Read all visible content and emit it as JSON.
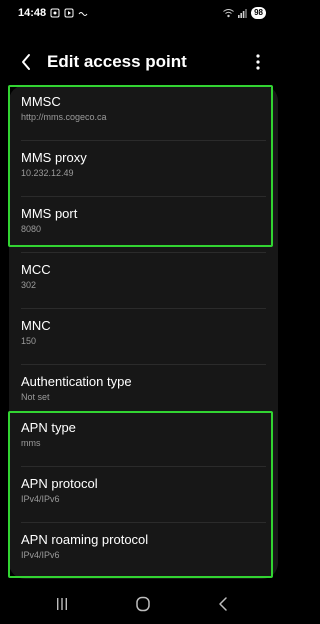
{
  "status": {
    "time": "14:48",
    "battery": "98"
  },
  "header": {
    "title": "Edit access point",
    "back_icon": "chevron-left-icon",
    "more_icon": "more-vertical-icon"
  },
  "items": [
    {
      "label": "MMSC",
      "value": "http://mms.cogeco.ca"
    },
    {
      "label": "MMS proxy",
      "value": "10.232.12.49"
    },
    {
      "label": "MMS port",
      "value": "8080"
    },
    {
      "label": "MCC",
      "value": "302"
    },
    {
      "label": "MNC",
      "value": "150"
    },
    {
      "label": "Authentication type",
      "value": "Not set"
    },
    {
      "label": "APN type",
      "value": "mms"
    },
    {
      "label": "APN protocol",
      "value": "IPv4/IPv6"
    },
    {
      "label": "APN roaming protocol",
      "value": "IPv4/IPv6"
    }
  ],
  "colors": {
    "background": "#000000",
    "card": "#171717",
    "highlight": "#32d432",
    "secondary_text": "#9b9b9b"
  },
  "nav": {
    "recents_icon": "recents-icon",
    "home_icon": "home-icon",
    "back_icon": "back-icon"
  }
}
